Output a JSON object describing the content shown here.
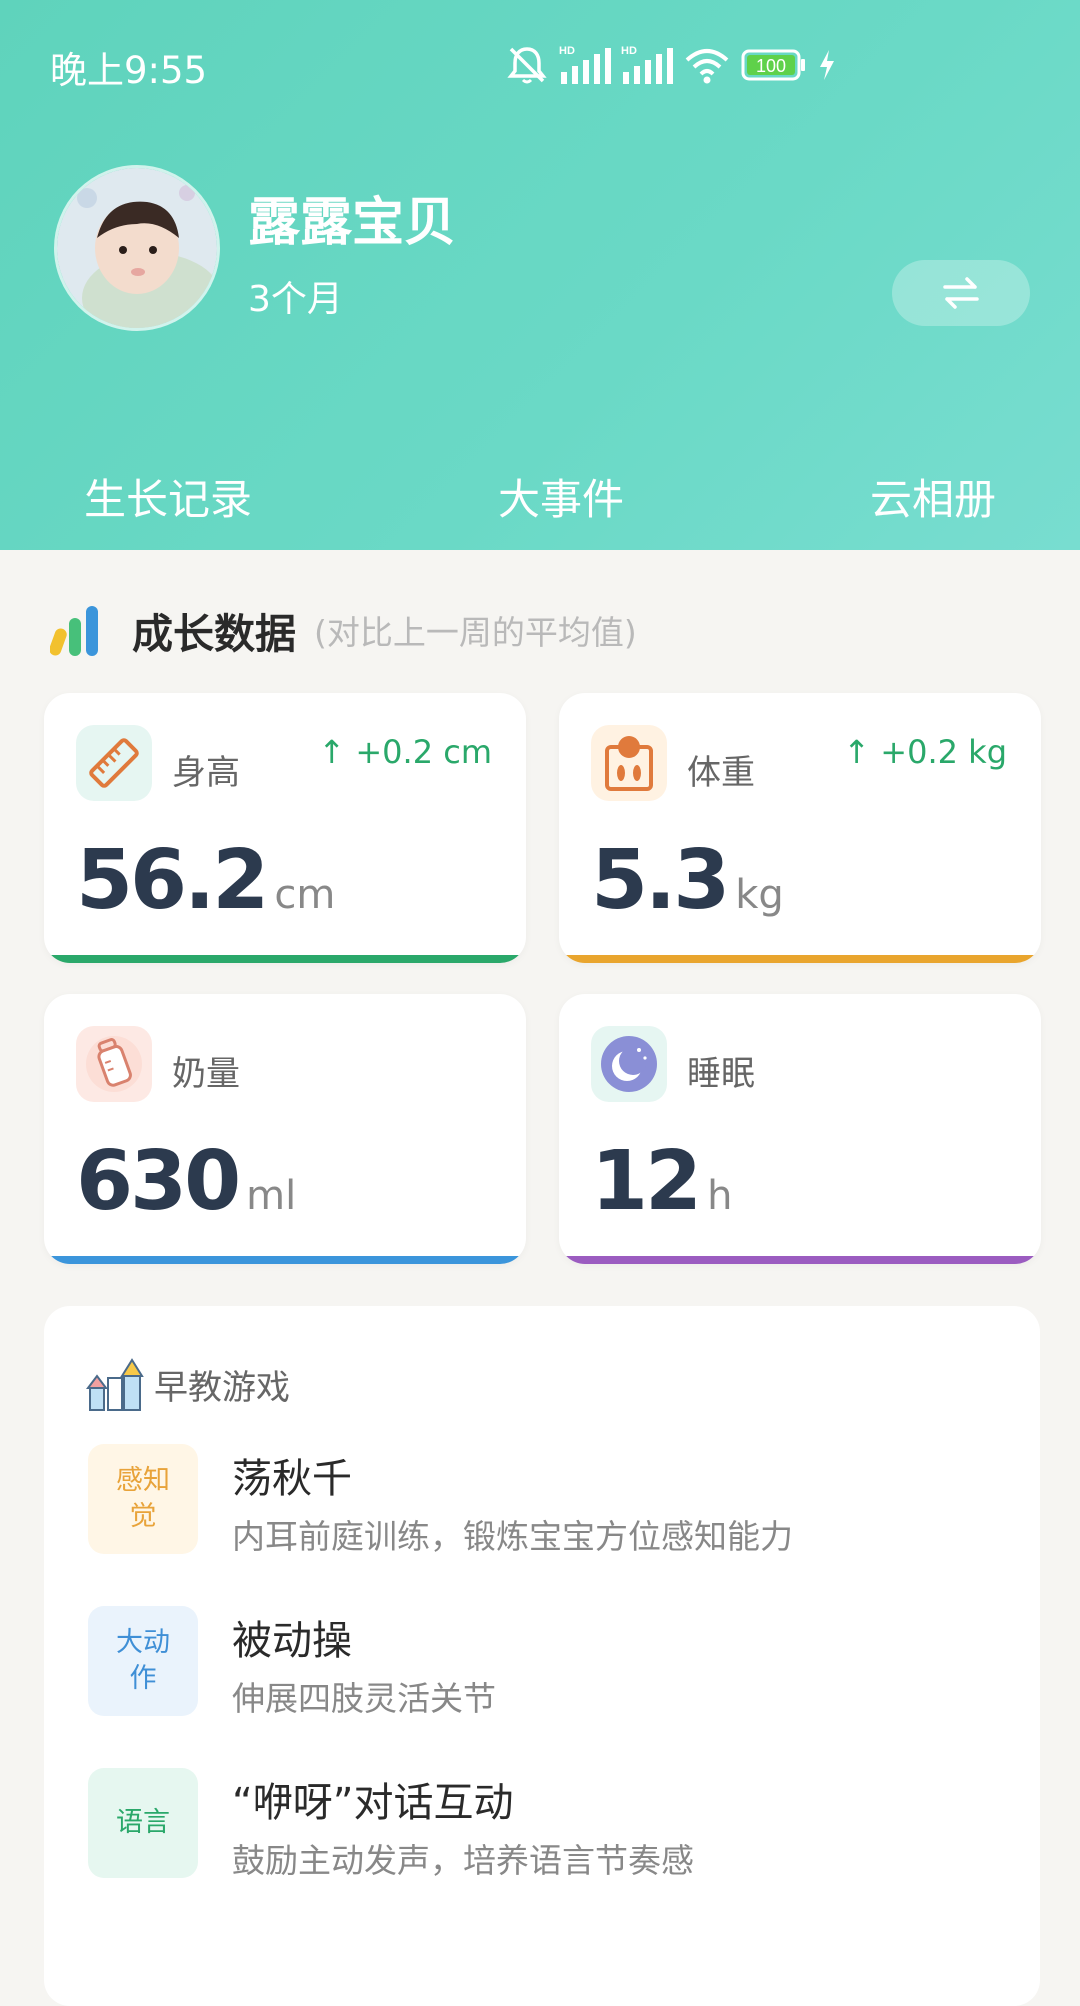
{
  "status": {
    "time": "晚上9:55",
    "battery": "100"
  },
  "profile": {
    "name": "露露宝贝",
    "age": "3个月",
    "switch_icon": "swap-arrows-icon"
  },
  "nav": {
    "tabs": [
      "生长记录",
      "大事件",
      "云相册"
    ]
  },
  "growth": {
    "title": "成长数据",
    "subtitle": "(对比上一周的平均值)",
    "cards": [
      {
        "label": "身高",
        "value": "56.2",
        "unit": "cm",
        "delta": "↑ +0.2 cm",
        "icon": "ruler-icon",
        "color": "#2aa86a"
      },
      {
        "label": "体重",
        "value": "5.3",
        "unit": "kg",
        "delta": "↑ +0.2 kg",
        "icon": "scale-icon",
        "color": "#e9a52e"
      },
      {
        "label": "奶量",
        "value": "630",
        "unit": "ml",
        "delta": "",
        "icon": "bottle-icon",
        "color": "#3b95db"
      },
      {
        "label": "睡眠",
        "value": "12",
        "unit": "h",
        "delta": "",
        "icon": "moon-icon",
        "color": "#9b5cc0"
      }
    ]
  },
  "games": {
    "title": "早教游戏",
    "items": [
      {
        "tag": "感知觉",
        "name": "荡秋千",
        "desc": "内耳前庭训练，锻炼宝宝方位感知能力",
        "tag_color": "#e8a33a",
        "tag_bg": "#fff6e6"
      },
      {
        "tag": "大动作",
        "name": "被动操",
        "desc": "伸展四肢灵活关节",
        "tag_color": "#3f8fd6",
        "tag_bg": "#eaf3fc"
      },
      {
        "tag": "语言",
        "name": "“咿呀”对话互动",
        "desc": "鼓励主动发声，培养语言节奏感",
        "tag_color": "#2aa86a",
        "tag_bg": "#e6f7f0"
      }
    ]
  }
}
